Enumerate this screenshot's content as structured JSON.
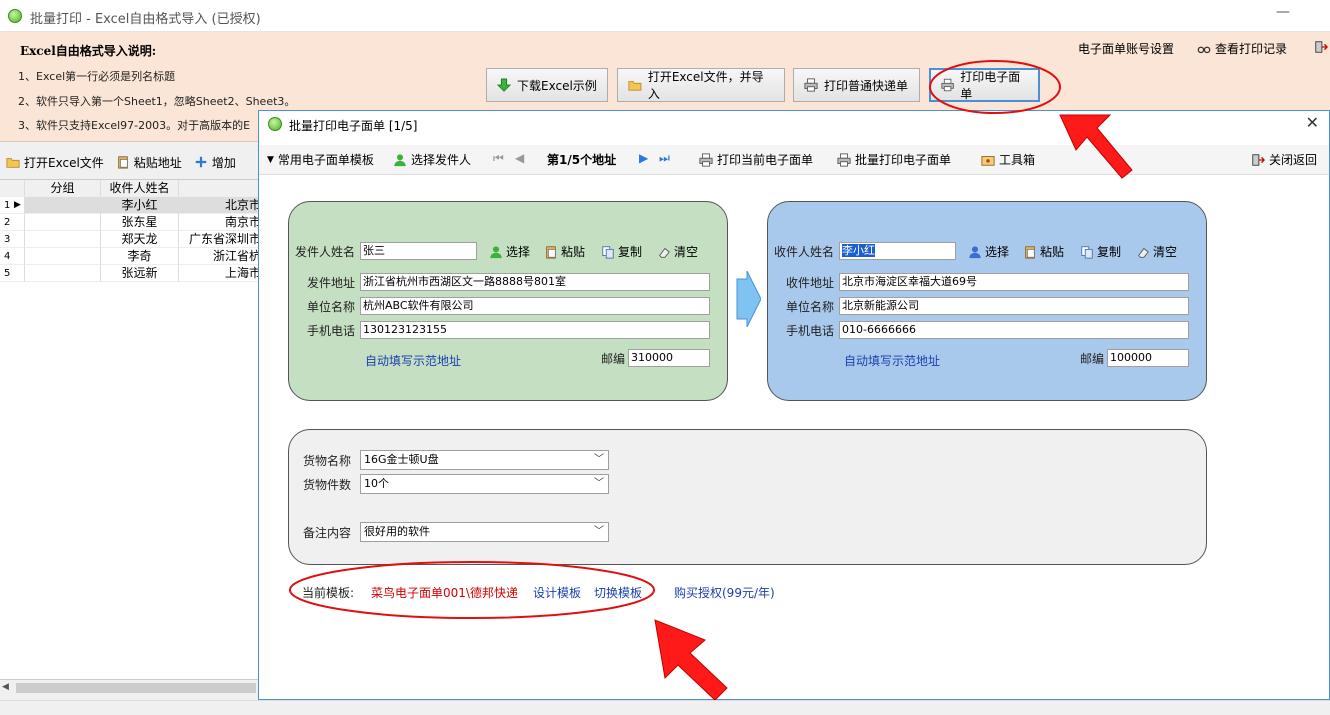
{
  "window": {
    "title": "批量打印 - Excel自由格式导入  (已授权)",
    "minimize": "—"
  },
  "instructions": {
    "heading": "Excel自由格式导入说明:",
    "lines": [
      "1、Excel第一行必须是列名标题",
      "2、软件只导入第一个Sheet1，忽略Sheet2、Sheet3。",
      "3、软件只支持Excel97-2003。对于高版本的E"
    ]
  },
  "top_buttons": {
    "download": "下载Excel示例",
    "open_import": "打开Excel文件，并导入",
    "print_normal": "打印普通快递单",
    "print_eorder": "打印电子面单"
  },
  "top_links": {
    "account": "电子面单账号设置",
    "records": "查看打印记录"
  },
  "left_toolbar": {
    "open": "打开Excel文件",
    "paste": "粘贴地址",
    "add": "增加"
  },
  "grid": {
    "columns": [
      "分组",
      "收件人姓名"
    ],
    "rows": [
      {
        "no": "1",
        "name": "李小红",
        "addr": "北京市"
      },
      {
        "no": "2",
        "name": "张东星",
        "addr": "南京市"
      },
      {
        "no": "3",
        "name": "郑天龙",
        "addr": "广东省深圳市"
      },
      {
        "no": "4",
        "name": "李奇",
        "addr": "浙江省杭"
      },
      {
        "no": "5",
        "name": "张远新",
        "addr": "上海市"
      }
    ]
  },
  "dialog": {
    "title": "批量打印电子面单 [1/5]",
    "close": "✕",
    "toolbar": {
      "templates": "常用电子面单模板",
      "select_sender": "选择发件人",
      "page": "第1/5个地址",
      "print_current": "打印当前电子面单",
      "print_batch": "批量打印电子面单",
      "toolbox": "工具箱",
      "close_return": "关闭返回"
    },
    "sender": {
      "name_label": "发件人姓名",
      "name": "张三",
      "addr_label": "发件地址",
      "addr": "浙江省杭州市西湖区文一路8888号801室",
      "company_label": "单位名称",
      "company": "杭州ABC软件有限公司",
      "phone_label": "手机电话",
      "phone": "130123123155",
      "autofill": "自动填写示范地址",
      "zip_label": "邮编",
      "zip": "310000"
    },
    "receiver": {
      "name_label": "收件人姓名",
      "name": "李小红",
      "addr_label": "收件地址",
      "addr": "北京市海淀区幸福大道69号",
      "company_label": "单位名称",
      "company": "北京新能源公司",
      "phone_label": "手机电话",
      "phone": "010-6666666",
      "autofill": "自动填写示范地址",
      "zip_label": "邮编",
      "zip": "100000"
    },
    "actions": {
      "select": "选择",
      "paste": "粘贴",
      "copy": "复制",
      "clear": "清空"
    },
    "goods": {
      "name_label": "货物名称",
      "name": "16G金士顿U盘",
      "count_label": "货物件数",
      "count": "10个",
      "remark_label": "备注内容",
      "remark": "很好用的软件"
    },
    "footer": {
      "current_label": "当前模板:",
      "current_value": "菜鸟电子面单001\\德邦快递",
      "design": "设计模板",
      "switch": "切换模板",
      "buy": "购买授权(99元/年)"
    }
  }
}
